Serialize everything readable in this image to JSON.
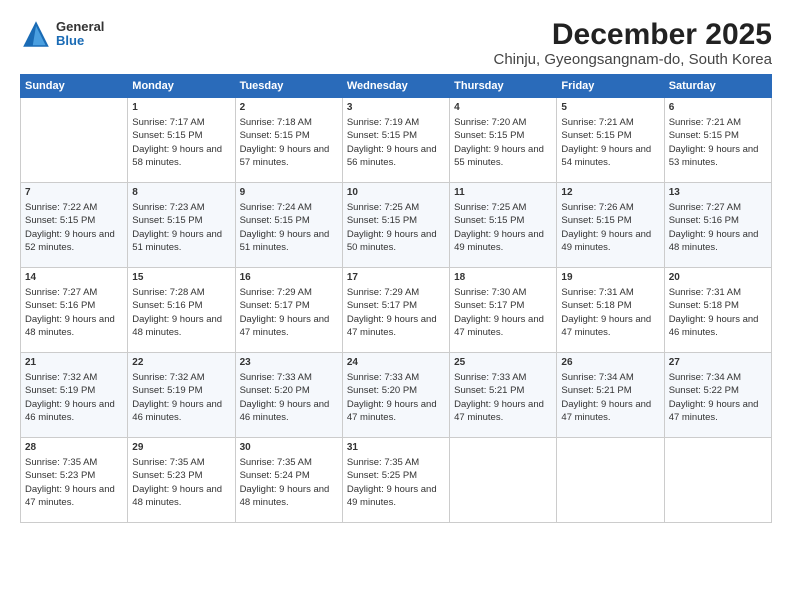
{
  "header": {
    "logo": {
      "general": "General",
      "blue": "Blue"
    },
    "title": "December 2025",
    "subtitle": "Chinju, Gyeongsangnam-do, South Korea"
  },
  "calendar": {
    "days": [
      "Sunday",
      "Monday",
      "Tuesday",
      "Wednesday",
      "Thursday",
      "Friday",
      "Saturday"
    ],
    "weeks": [
      [
        {
          "day": "",
          "content": ""
        },
        {
          "day": "1",
          "sunrise": "Sunrise: 7:17 AM",
          "sunset": "Sunset: 5:15 PM",
          "daylight": "Daylight: 9 hours and 58 minutes."
        },
        {
          "day": "2",
          "sunrise": "Sunrise: 7:18 AM",
          "sunset": "Sunset: 5:15 PM",
          "daylight": "Daylight: 9 hours and 57 minutes."
        },
        {
          "day": "3",
          "sunrise": "Sunrise: 7:19 AM",
          "sunset": "Sunset: 5:15 PM",
          "daylight": "Daylight: 9 hours and 56 minutes."
        },
        {
          "day": "4",
          "sunrise": "Sunrise: 7:20 AM",
          "sunset": "Sunset: 5:15 PM",
          "daylight": "Daylight: 9 hours and 55 minutes."
        },
        {
          "day": "5",
          "sunrise": "Sunrise: 7:21 AM",
          "sunset": "Sunset: 5:15 PM",
          "daylight": "Daylight: 9 hours and 54 minutes."
        },
        {
          "day": "6",
          "sunrise": "Sunrise: 7:21 AM",
          "sunset": "Sunset: 5:15 PM",
          "daylight": "Daylight: 9 hours and 53 minutes."
        }
      ],
      [
        {
          "day": "7",
          "sunrise": "Sunrise: 7:22 AM",
          "sunset": "Sunset: 5:15 PM",
          "daylight": "Daylight: 9 hours and 52 minutes."
        },
        {
          "day": "8",
          "sunrise": "Sunrise: 7:23 AM",
          "sunset": "Sunset: 5:15 PM",
          "daylight": "Daylight: 9 hours and 51 minutes."
        },
        {
          "day": "9",
          "sunrise": "Sunrise: 7:24 AM",
          "sunset": "Sunset: 5:15 PM",
          "daylight": "Daylight: 9 hours and 51 minutes."
        },
        {
          "day": "10",
          "sunrise": "Sunrise: 7:25 AM",
          "sunset": "Sunset: 5:15 PM",
          "daylight": "Daylight: 9 hours and 50 minutes."
        },
        {
          "day": "11",
          "sunrise": "Sunrise: 7:25 AM",
          "sunset": "Sunset: 5:15 PM",
          "daylight": "Daylight: 9 hours and 49 minutes."
        },
        {
          "day": "12",
          "sunrise": "Sunrise: 7:26 AM",
          "sunset": "Sunset: 5:15 PM",
          "daylight": "Daylight: 9 hours and 49 minutes."
        },
        {
          "day": "13",
          "sunrise": "Sunrise: 7:27 AM",
          "sunset": "Sunset: 5:16 PM",
          "daylight": "Daylight: 9 hours and 48 minutes."
        }
      ],
      [
        {
          "day": "14",
          "sunrise": "Sunrise: 7:27 AM",
          "sunset": "Sunset: 5:16 PM",
          "daylight": "Daylight: 9 hours and 48 minutes."
        },
        {
          "day": "15",
          "sunrise": "Sunrise: 7:28 AM",
          "sunset": "Sunset: 5:16 PM",
          "daylight": "Daylight: 9 hours and 48 minutes."
        },
        {
          "day": "16",
          "sunrise": "Sunrise: 7:29 AM",
          "sunset": "Sunset: 5:17 PM",
          "daylight": "Daylight: 9 hours and 47 minutes."
        },
        {
          "day": "17",
          "sunrise": "Sunrise: 7:29 AM",
          "sunset": "Sunset: 5:17 PM",
          "daylight": "Daylight: 9 hours and 47 minutes."
        },
        {
          "day": "18",
          "sunrise": "Sunrise: 7:30 AM",
          "sunset": "Sunset: 5:17 PM",
          "daylight": "Daylight: 9 hours and 47 minutes."
        },
        {
          "day": "19",
          "sunrise": "Sunrise: 7:31 AM",
          "sunset": "Sunset: 5:18 PM",
          "daylight": "Daylight: 9 hours and 47 minutes."
        },
        {
          "day": "20",
          "sunrise": "Sunrise: 7:31 AM",
          "sunset": "Sunset: 5:18 PM",
          "daylight": "Daylight: 9 hours and 46 minutes."
        }
      ],
      [
        {
          "day": "21",
          "sunrise": "Sunrise: 7:32 AM",
          "sunset": "Sunset: 5:19 PM",
          "daylight": "Daylight: 9 hours and 46 minutes."
        },
        {
          "day": "22",
          "sunrise": "Sunrise: 7:32 AM",
          "sunset": "Sunset: 5:19 PM",
          "daylight": "Daylight: 9 hours and 46 minutes."
        },
        {
          "day": "23",
          "sunrise": "Sunrise: 7:33 AM",
          "sunset": "Sunset: 5:20 PM",
          "daylight": "Daylight: 9 hours and 46 minutes."
        },
        {
          "day": "24",
          "sunrise": "Sunrise: 7:33 AM",
          "sunset": "Sunset: 5:20 PM",
          "daylight": "Daylight: 9 hours and 47 minutes."
        },
        {
          "day": "25",
          "sunrise": "Sunrise: 7:33 AM",
          "sunset": "Sunset: 5:21 PM",
          "daylight": "Daylight: 9 hours and 47 minutes."
        },
        {
          "day": "26",
          "sunrise": "Sunrise: 7:34 AM",
          "sunset": "Sunset: 5:21 PM",
          "daylight": "Daylight: 9 hours and 47 minutes."
        },
        {
          "day": "27",
          "sunrise": "Sunrise: 7:34 AM",
          "sunset": "Sunset: 5:22 PM",
          "daylight": "Daylight: 9 hours and 47 minutes."
        }
      ],
      [
        {
          "day": "28",
          "sunrise": "Sunrise: 7:35 AM",
          "sunset": "Sunset: 5:23 PM",
          "daylight": "Daylight: 9 hours and 47 minutes."
        },
        {
          "day": "29",
          "sunrise": "Sunrise: 7:35 AM",
          "sunset": "Sunset: 5:23 PM",
          "daylight": "Daylight: 9 hours and 48 minutes."
        },
        {
          "day": "30",
          "sunrise": "Sunrise: 7:35 AM",
          "sunset": "Sunset: 5:24 PM",
          "daylight": "Daylight: 9 hours and 48 minutes."
        },
        {
          "day": "31",
          "sunrise": "Sunrise: 7:35 AM",
          "sunset": "Sunset: 5:25 PM",
          "daylight": "Daylight: 9 hours and 49 minutes."
        },
        {
          "day": "",
          "content": ""
        },
        {
          "day": "",
          "content": ""
        },
        {
          "day": "",
          "content": ""
        }
      ]
    ]
  }
}
